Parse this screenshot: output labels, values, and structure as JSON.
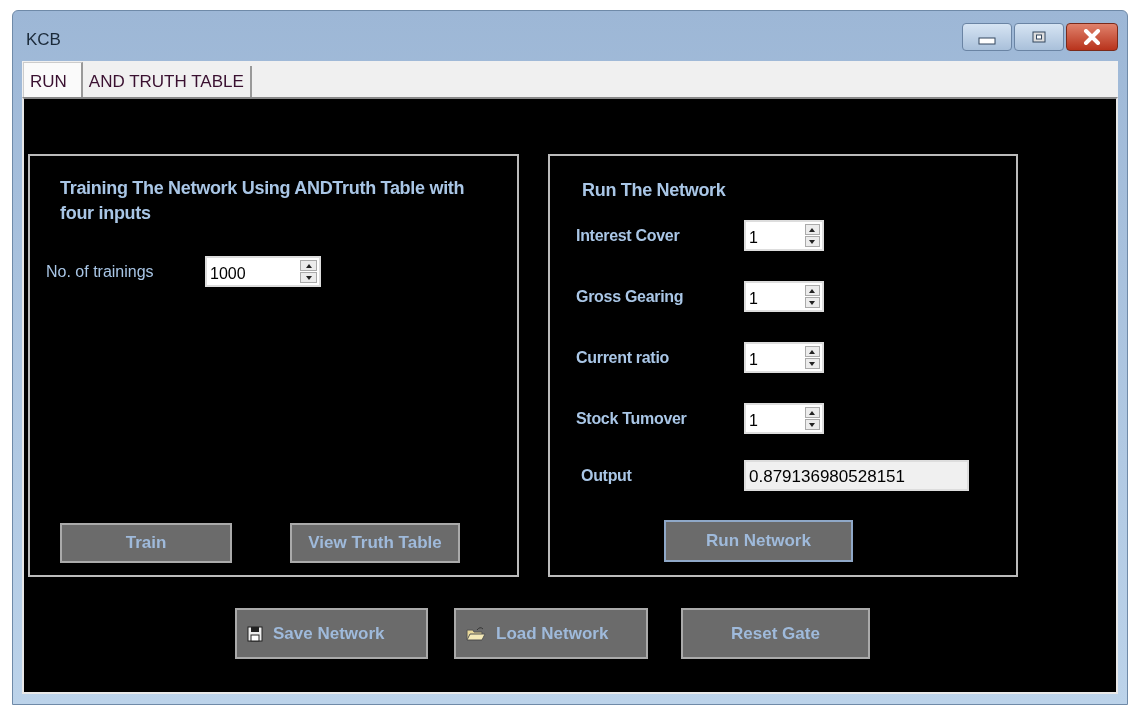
{
  "window": {
    "title": "KCB"
  },
  "tabs": [
    {
      "label": "RUN",
      "selected": true
    },
    {
      "label": "AND TRUTH TABLE",
      "selected": false
    }
  ],
  "training_panel": {
    "title": "Training The Network Using ANDTruth Table with four inputs",
    "field": {
      "label": "No. of trainings",
      "value": "1000"
    },
    "buttons": [
      "Train",
      "View Truth Table"
    ]
  },
  "run_panel": {
    "title": "Run The Network",
    "inputs": [
      {
        "label": "Interest Cover",
        "value": "1"
      },
      {
        "label": "Gross Gearing",
        "value": "1"
      },
      {
        "label": "Current ratio",
        "value": "1"
      },
      {
        "label": "Stock Tumover",
        "value": "1"
      }
    ],
    "output": {
      "label": "Output",
      "value": "0.879136980528151"
    },
    "button": "Run Network"
  },
  "buttons": [
    {
      "label": "Save Network",
      "kind": "save"
    },
    {
      "label": "Load Network",
      "kind": "load"
    },
    {
      "label": "Reset Gate",
      "kind": "plain"
    }
  ]
}
